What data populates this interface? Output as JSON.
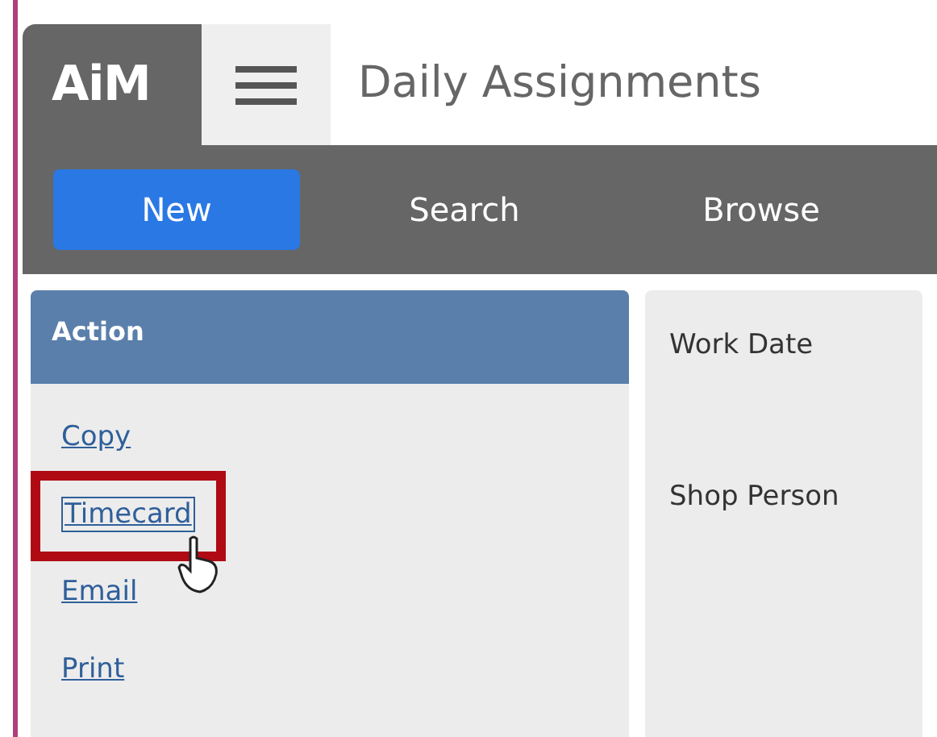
{
  "app": {
    "logo": "AiM",
    "title": "Daily Assignments"
  },
  "nav": [
    {
      "label": "New",
      "selected": true
    },
    {
      "label": "Search",
      "selected": false
    },
    {
      "label": "Browse",
      "selected": false
    }
  ],
  "action_panel": {
    "heading": "Action",
    "links": [
      {
        "label": "Copy",
        "highlighted": false
      },
      {
        "label": "Timecard",
        "highlighted": true
      },
      {
        "label": "Email",
        "highlighted": false
      },
      {
        "label": "Print",
        "highlighted": false
      }
    ]
  },
  "form": {
    "fields": [
      {
        "label": "Work Date"
      },
      {
        "label": "Shop Person"
      }
    ]
  }
}
